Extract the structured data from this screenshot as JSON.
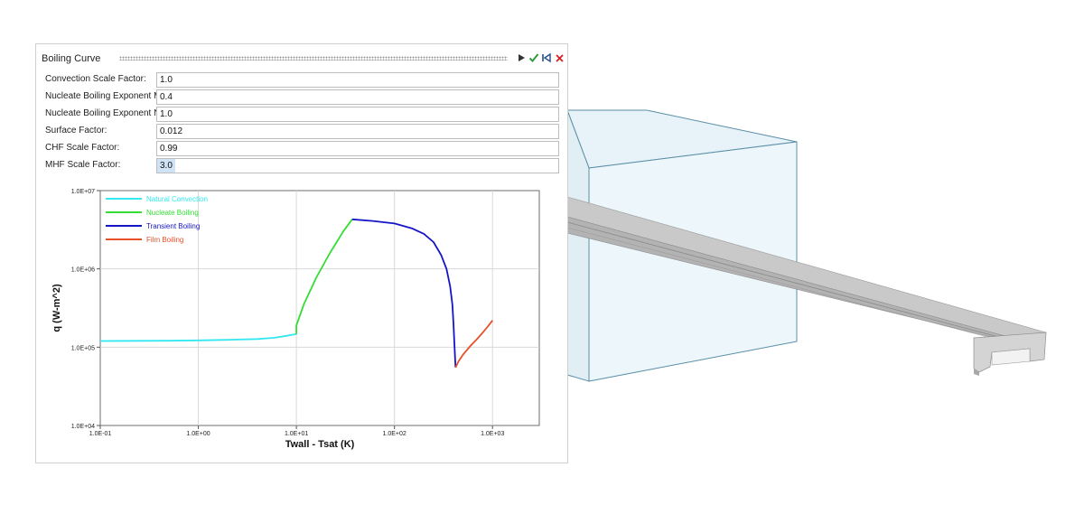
{
  "panel": {
    "title": "Boiling Curve",
    "icons": [
      "play-icon",
      "check-icon",
      "reset-icon",
      "close-icon"
    ],
    "fields": [
      {
        "label": "Convection Scale Factor:",
        "value": "1.0"
      },
      {
        "label": "Nucleate Boiling Exponent M:",
        "value": "0.4"
      },
      {
        "label": "Nucleate Boiling Exponent N:",
        "value": "1.0"
      },
      {
        "label": "Surface Factor:",
        "value": "0.012"
      },
      {
        "label": "CHF Scale Factor:",
        "value": "0.99"
      },
      {
        "label": "MHF Scale Factor:",
        "value": "3.0"
      }
    ]
  },
  "colors": {
    "accent_check": "#2e9e3a",
    "accent_close": "#d42020",
    "wireframe": "#5a8fa8"
  },
  "chart_data": {
    "type": "line",
    "xlabel": "Twall - Tsat (K)",
    "ylabel": "q (W-m^2)",
    "xscale": "log",
    "yscale": "log",
    "xlim": [
      0.1,
      3000
    ],
    "ylim": [
      10000,
      10000000
    ],
    "xticks": [
      0.1,
      1,
      10,
      100,
      1000
    ],
    "xtick_labels": [
      "1.0E-01",
      "1.0E+00",
      "1.0E+01",
      "1.0E+02",
      "1.0E+03"
    ],
    "yticks": [
      10000,
      100000,
      1000000,
      10000000
    ],
    "ytick_labels": [
      "1.0E+04",
      "1.0E+05",
      "1.0E+06",
      "1.0E+07"
    ],
    "grid": true,
    "legend_position": "top-left",
    "series": [
      {
        "name": "Natural Convection",
        "color": "#33e8f0",
        "x": [
          0.1,
          0.5,
          1,
          2,
          4,
          6,
          8,
          10
        ],
        "y": [
          120000,
          121000,
          122000,
          124000,
          127000,
          132000,
          140000,
          147000
        ]
      },
      {
        "name": "Nucleate Boiling",
        "color": "#33dd33",
        "x": [
          10,
          10,
          12,
          16,
          22,
          30,
          37
        ],
        "y": [
          147000,
          190000,
          360000,
          780000,
          1600000,
          3000000,
          4300000
        ]
      },
      {
        "name": "Transient Boiling",
        "color": "#1515c8",
        "x": [
          37,
          60,
          100,
          150,
          200,
          250,
          300,
          340,
          370,
          390,
          400,
          410,
          420
        ],
        "y": [
          4300000,
          4100000,
          3800000,
          3300000,
          2800000,
          2200000,
          1500000,
          1000000,
          600000,
          350000,
          200000,
          100000,
          55000
        ]
      },
      {
        "name": "Film Boiling",
        "color": "#e8502a",
        "x": [
          420,
          450,
          500,
          600,
          700,
          800,
          900,
          1000
        ],
        "y": [
          55000,
          66000,
          80000,
          105000,
          128000,
          155000,
          185000,
          220000
        ]
      }
    ]
  }
}
